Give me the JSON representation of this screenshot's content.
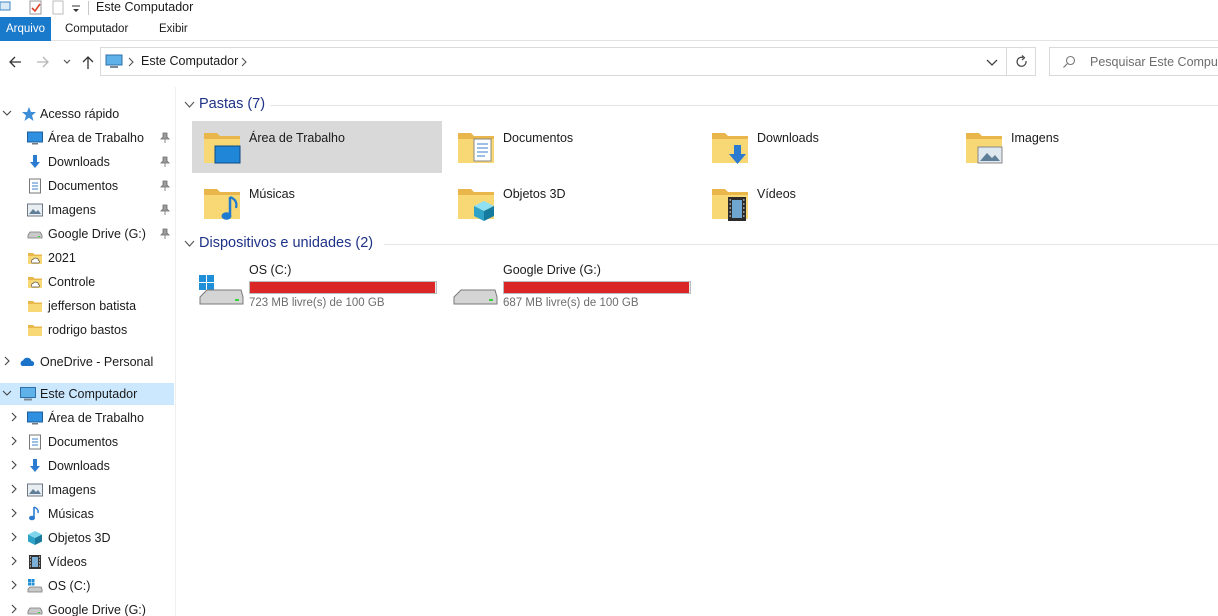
{
  "window": {
    "title": "Este Computador"
  },
  "ribbon": {
    "tabs": [
      "Arquivo",
      "Computador",
      "Exibir"
    ]
  },
  "address": {
    "path": "Este Computador"
  },
  "search": {
    "placeholder": "Pesquisar Este Computador"
  },
  "nav": {
    "quick_access": {
      "label": "Acesso rápido",
      "items": [
        {
          "label": "Área de Trabalho",
          "icon": "desktop-icon",
          "pinned": true
        },
        {
          "label": "Downloads",
          "icon": "downloads-icon",
          "pinned": true
        },
        {
          "label": "Documentos",
          "icon": "documents-icon",
          "pinned": true
        },
        {
          "label": "Imagens",
          "icon": "pictures-icon",
          "pinned": true
        },
        {
          "label": "Google Drive (G:)",
          "icon": "drive-icon",
          "pinned": true
        },
        {
          "label": "2021",
          "icon": "cloud-folder-icon",
          "pinned": false
        },
        {
          "label": "Controle",
          "icon": "cloud-folder-icon",
          "pinned": false
        },
        {
          "label": "jefferson batista",
          "icon": "folder-icon",
          "pinned": false
        },
        {
          "label": "rodrigo bastos",
          "icon": "folder-icon",
          "pinned": false
        }
      ]
    },
    "onedrive": {
      "label": "OneDrive - Personal"
    },
    "this_pc": {
      "label": "Este Computador",
      "items": [
        {
          "label": "Área de Trabalho",
          "icon": "desktop-icon"
        },
        {
          "label": "Documentos",
          "icon": "documents-icon"
        },
        {
          "label": "Downloads",
          "icon": "downloads-icon"
        },
        {
          "label": "Imagens",
          "icon": "pictures-icon"
        },
        {
          "label": "Músicas",
          "icon": "music-icon"
        },
        {
          "label": "Objetos 3D",
          "icon": "3d-objects-icon"
        },
        {
          "label": "Vídeos",
          "icon": "videos-icon"
        },
        {
          "label": "OS (C:)",
          "icon": "windows-drive-icon"
        },
        {
          "label": "Google Drive (G:)",
          "icon": "drive-icon"
        }
      ]
    }
  },
  "content": {
    "folders_group": "Pastas (7)",
    "folders": [
      {
        "name": "Área de Trabalho",
        "icon": "desktop-folder-icon"
      },
      {
        "name": "Documentos",
        "icon": "documents-folder-icon"
      },
      {
        "name": "Downloads",
        "icon": "downloads-folder-icon"
      },
      {
        "name": "Imagens",
        "icon": "pictures-folder-icon"
      },
      {
        "name": "Músicas",
        "icon": "music-folder-icon"
      },
      {
        "name": "Objetos 3D",
        "icon": "3d-objects-folder-icon"
      },
      {
        "name": "Vídeos",
        "icon": "videos-folder-icon"
      }
    ],
    "drives_group": "Dispositivos e unidades (2)",
    "drives": [
      {
        "name": "OS (C:)",
        "free": "723 MB livre(s) de 100 GB",
        "used_fraction": 0.993,
        "icon": "windows-drive-icon"
      },
      {
        "name": "Google Drive (G:)",
        "free": "687 MB livre(s) de 100 GB",
        "used_fraction": 0.993,
        "icon": "drive-icon"
      }
    ]
  },
  "colors": {
    "accent": "#1979ca",
    "selection": "#cce8ff",
    "folder": "#f8d775",
    "drive_full": "#da2626",
    "group_header": "#1e3287"
  }
}
